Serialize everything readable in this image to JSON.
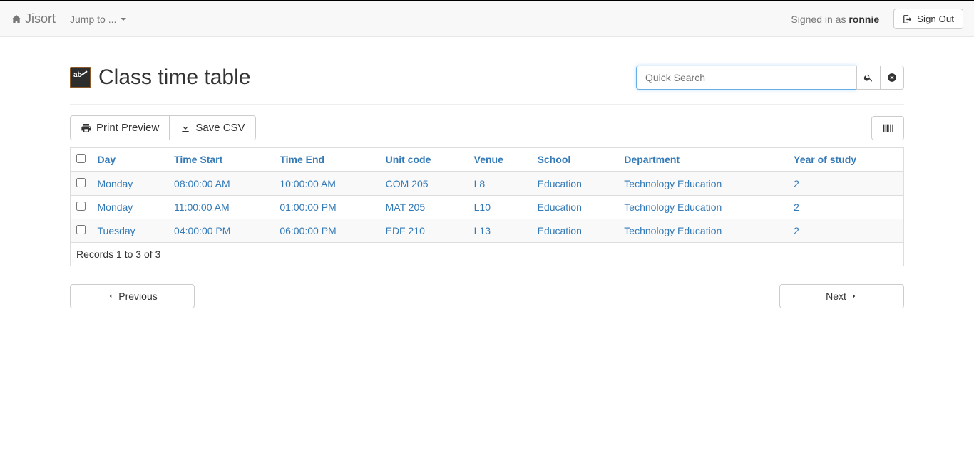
{
  "nav": {
    "brand": "Jisort",
    "jump": "Jump to ...",
    "signed_in_prefix": "Signed in as ",
    "username": "ronnie",
    "signout": "Sign Out"
  },
  "page": {
    "title": "Class time table"
  },
  "search": {
    "placeholder": "Quick Search"
  },
  "toolbar": {
    "print": "Print Preview",
    "savecsv": "Save CSV"
  },
  "columns": {
    "day": "Day",
    "time_start": "Time Start",
    "time_end": "Time End",
    "unit_code": "Unit code",
    "venue": "Venue",
    "school": "School",
    "department": "Department",
    "year": "Year of study"
  },
  "rows": [
    {
      "day": "Monday",
      "time_start": "08:00:00 AM",
      "time_end": "10:00:00 AM",
      "unit_code": "COM 205",
      "venue": "L8",
      "school": "Education",
      "department": "Technology Education",
      "year": "2"
    },
    {
      "day": "Monday",
      "time_start": "11:00:00 AM",
      "time_end": "01:00:00 PM",
      "unit_code": "MAT 205",
      "venue": "L10",
      "school": "Education",
      "department": "Technology Education",
      "year": "2"
    },
    {
      "day": "Tuesday",
      "time_start": "04:00:00 PM",
      "time_end": "06:00:00 PM",
      "unit_code": "EDF 210",
      "venue": "L13",
      "school": "Education",
      "department": "Technology Education",
      "year": "2"
    }
  ],
  "records_text": "Records 1 to 3 of 3",
  "pager": {
    "prev": "Previous",
    "next": "Next"
  }
}
